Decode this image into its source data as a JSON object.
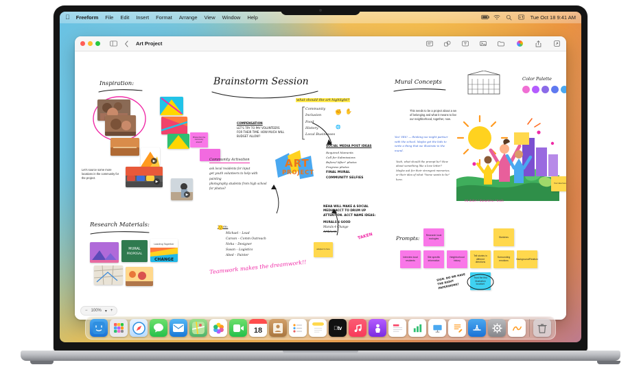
{
  "menubar": {
    "apple_icon": "apple-icon",
    "items": [
      "Freeform",
      "File",
      "Edit",
      "Insert",
      "Format",
      "Arrange",
      "View",
      "Window",
      "Help"
    ],
    "status_icons": [
      "battery-icon",
      "wifi-icon",
      "search-icon",
      "control-center-icon"
    ],
    "clock": "Tue Oct 18  9:41 AM"
  },
  "window": {
    "title": "Art Project",
    "traffic_lights": [
      "close-button",
      "minimize-button",
      "zoom-button"
    ],
    "sidebar_toggle_icon": "sidebar-icon",
    "back_icon": "chevron-left-icon",
    "toolbar_icons": [
      "sticky-note-icon",
      "shapes-icon",
      "text-box-icon",
      "media-icon",
      "insert-file-icon"
    ],
    "right_icons": [
      "collaborate-icon",
      "share-icon",
      "zoom-icon"
    ],
    "zoom": {
      "minus": "−",
      "level": "100%",
      "chevron": "▾",
      "plus": "+"
    }
  },
  "canvas": {
    "headings": {
      "inspiration": "Inspiration:",
      "research_materials": "Research Materials:",
      "brainstorm": "Brainstorm Session",
      "mural_concepts": "Mural Concepts",
      "color_palette": "Color Palette",
      "prompts": "Prompts:"
    },
    "inspiration_note": "Let's source some more locations in the community for the project.",
    "sticky_pink_small": "Photos from the community around!",
    "compensation": {
      "title": "COMPENSATION",
      "body": "LET'S TRY TO PAY VOLUNTEERS FOR THEIR TIME. HOW MUCH WILL BUDGET ALLOW?"
    },
    "highlight_question": "what should the art highlight?",
    "highlight_list": [
      "Community",
      "Inclusion",
      "Food",
      "History",
      "Local Businesses"
    ],
    "community_activation": {
      "title": "Community Activation",
      "items": [
        "ask local residents for input",
        "get youth volunteers to help with painting",
        "photography students from high school for photos?"
      ]
    },
    "art_project_label": {
      "line1": "ART",
      "line2": "PROJECT"
    },
    "social_media": {
      "title": "SOCIAL MEDIA POST IDEAS",
      "items": [
        "Required Moments",
        "Call for Submissions",
        "Before/\"After\" photos",
        "Progress photos",
        "FINAL MURAL",
        "COMMUNITY SELFIES"
      ]
    },
    "team": {
      "title": "Team:",
      "members": [
        "Michael – Lead",
        "Carson – Comm Outreach",
        "Neha – Designer",
        "Susan – Logistics",
        "Abed – Painter"
      ]
    },
    "neha_note": {
      "body": "NEHA WILL MAKE A SOCIAL MEDIA ACCT TO DRUM UP ATTENTION. ACCT NAME IDEAS:",
      "ideas": [
        "MURALS 4 GOOD",
        "Murals 4 Change",
        "Artbloom"
      ],
      "stamp": "TAKEN"
    },
    "teamwork_note": "Teamwork makes the dreamwork!!",
    "adapted_note": "adapted to here",
    "belonging_note": "This needs to be a project about a sense of belonging and what it means to live in our neighborhood, together, now.",
    "yes_note": "Yes! YES! — thinking we might partner with the school. Maybe get the kids to write a thing that we illustrate in the mural.",
    "prompt_note": "Yeah, what should the prompt be? How about something like a love letter? Maybe ask for their strongest memories, or their idea of what \"home wants to be\" here.",
    "mural_caption": "mi dolor / dunamica / tools",
    "mural_side_note": "Your idea here",
    "sticky_rows": {
      "pink": [
        "Research local ecologies",
        "Interview local residents",
        "Site specific information",
        "Neighborhood history"
      ],
      "yellow": [
        "Sketches",
        "Tell stories in different directions",
        "Surrounding emotions",
        "Background/Realism"
      ],
      "cyan": "Trust the first illustration location!"
    },
    "sign_note": "SIGN. DO WE HAVE THE RIGHT PAPERWORK?",
    "research_images": [
      "MURAL PROPOSAL",
      "Leading Together",
      "CHANGE"
    ],
    "colors": {
      "accent_pink": "#f02aa6",
      "sticky_pink": "#f977e8",
      "sticky_yellow": "#ffd84d",
      "sticky_cyan": "#3fd2f2",
      "highlight_yellow": "#ffe94d",
      "palette": [
        "#f06fd4",
        "#b45cff",
        "#8a6ae8",
        "#5f79f0",
        "#4aa8f0"
      ]
    }
  },
  "dock": {
    "apps": [
      "finder",
      "launchpad",
      "safari",
      "messages",
      "mail",
      "maps",
      "photos",
      "facetime",
      "calendar",
      "contacts",
      "reminders",
      "notes",
      "tv",
      "music",
      "podcasts",
      "news",
      "numbers",
      "keynote",
      "pages",
      "appstore",
      "settings",
      "freeform",
      "trash"
    ],
    "calendar_day": "18"
  }
}
